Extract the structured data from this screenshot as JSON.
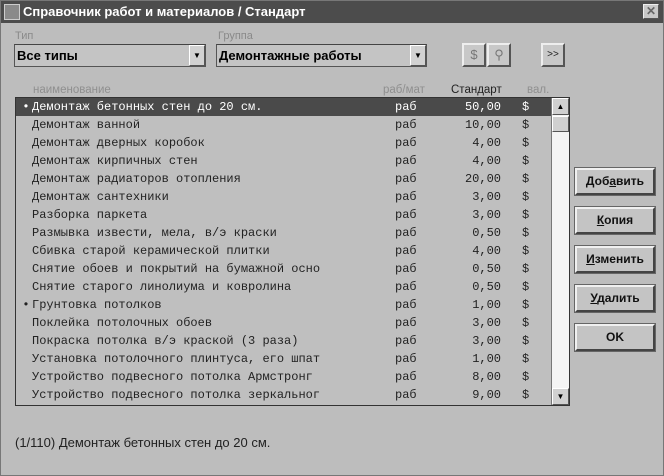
{
  "window": {
    "title": "Справочник работ и материалов / Стандарт",
    "close": "✕"
  },
  "filters": {
    "type_label": "Тип",
    "type_value": "Все типы",
    "group_label": "Группа",
    "group_value": "Демонтажные работы"
  },
  "toolbar": {
    "currency": "$",
    "find_icon": "binoculars-icon",
    "more": ">>"
  },
  "columns": {
    "name": "наименование",
    "kind": "раб/мат",
    "standard": "Стандарт",
    "currency": "вал."
  },
  "rows": [
    {
      "mark": "•",
      "name": "Демонтаж бетонных стен до 20 см.",
      "kind": "раб",
      "value": "50,00",
      "cur": "$"
    },
    {
      "mark": "",
      "name": "Демонтаж ванной",
      "kind": "раб",
      "value": "10,00",
      "cur": "$"
    },
    {
      "mark": "",
      "name": "Демонтаж дверных коробок",
      "kind": "раб",
      "value": "4,00",
      "cur": "$"
    },
    {
      "mark": "",
      "name": "Демонтаж кирпичных стен",
      "kind": "раб",
      "value": "4,00",
      "cur": "$"
    },
    {
      "mark": "",
      "name": "Демонтаж радиаторов отопления",
      "kind": "раб",
      "value": "20,00",
      "cur": "$"
    },
    {
      "mark": "",
      "name": "Демонтаж сантехники",
      "kind": "раб",
      "value": "3,00",
      "cur": "$"
    },
    {
      "mark": "",
      "name": "Разборка паркета",
      "kind": "раб",
      "value": "3,00",
      "cur": "$"
    },
    {
      "mark": "",
      "name": "Размывка извести, мела, в/э краски",
      "kind": "раб",
      "value": "0,50",
      "cur": "$"
    },
    {
      "mark": "",
      "name": "Сбивка старой керамической плитки",
      "kind": "раб",
      "value": "4,00",
      "cur": "$"
    },
    {
      "mark": "",
      "name": "Снятие обоев и покрытий на бумажной осно",
      "kind": "раб",
      "value": "0,50",
      "cur": "$"
    },
    {
      "mark": "",
      "name": "Снятие старого линолиума и ковролина",
      "kind": "раб",
      "value": "0,50",
      "cur": "$"
    },
    {
      "mark": "•",
      "name": "Грунтовка потолков",
      "kind": "раб",
      "value": "1,00",
      "cur": "$"
    },
    {
      "mark": "",
      "name": "Поклейка потолочных обоев",
      "kind": "раб",
      "value": "3,00",
      "cur": "$"
    },
    {
      "mark": "",
      "name": "Покраска потолка в/э краской (3 раза)",
      "kind": "раб",
      "value": "3,00",
      "cur": "$"
    },
    {
      "mark": "",
      "name": "Установка потолочного плинтуса, его шпат",
      "kind": "раб",
      "value": "1,00",
      "cur": "$"
    },
    {
      "mark": "",
      "name": "Устройство подвесного потолка Армстронг",
      "kind": "раб",
      "value": "8,00",
      "cur": "$"
    },
    {
      "mark": "",
      "name": "Устройство подвесного потолка зеркальног",
      "kind": "раб",
      "value": "9,00",
      "cur": "$"
    }
  ],
  "buttons": {
    "add": {
      "pre": "Доб",
      "u": "а",
      "post": "вить"
    },
    "copy": {
      "pre": "",
      "u": "К",
      "post": "опия"
    },
    "edit": {
      "pre": "",
      "u": "И",
      "post": "зменить"
    },
    "delete": {
      "pre": "",
      "u": "У",
      "post": "далить"
    },
    "ok": {
      "pre": "OK",
      "u": "",
      "post": ""
    }
  },
  "status": "(1/110)  Демонтаж бетонных стен до 20 см."
}
